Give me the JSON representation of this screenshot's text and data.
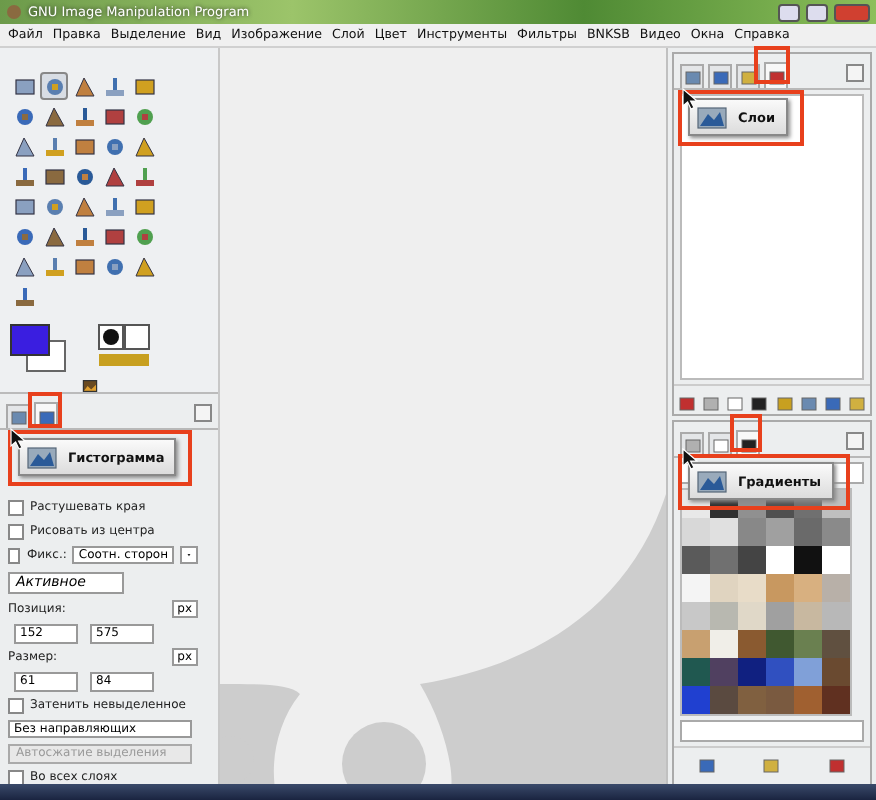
{
  "window": {
    "title": "GNU Image Manipulation Program"
  },
  "menu": [
    "Файл",
    "Правка",
    "Выделение",
    "Вид",
    "Изображение",
    "Слой",
    "Цвет",
    "Инструменты",
    "Фильтры",
    "BNKSB",
    "Видео",
    "Окна",
    "Справка"
  ],
  "toolbox": {
    "tools": [
      {
        "selected": false
      },
      {
        "selected": true
      },
      {
        "selected": false
      },
      {
        "selected": false
      },
      {
        "selected": false
      },
      {
        "selected": false
      },
      {
        "selected": false
      },
      {
        "selected": false
      },
      {
        "selected": false
      },
      {
        "selected": false
      },
      {
        "selected": false
      },
      {
        "selected": false
      },
      {
        "selected": false
      },
      {
        "selected": false
      },
      {
        "selected": false
      },
      {
        "selected": false
      },
      {
        "selected": false
      },
      {
        "selected": false
      },
      {
        "selected": false
      },
      {
        "selected": false
      },
      {
        "selected": false
      },
      {
        "selected": false
      },
      {
        "selected": false
      },
      {
        "selected": false
      },
      {
        "selected": false
      },
      {
        "selected": false
      },
      {
        "selected": false
      },
      {
        "selected": false
      },
      {
        "selected": false
      },
      {
        "selected": false
      },
      {
        "selected": false
      },
      {
        "selected": false
      },
      {
        "selected": false
      },
      {
        "selected": false
      },
      {
        "selected": false
      },
      {
        "selected": false
      }
    ]
  },
  "left_dock": {
    "tabs": [
      {
        "selected": false
      },
      {
        "selected": true
      }
    ],
    "tooltip": "Гистограмма",
    "options": [
      {
        "kind": "checkbox",
        "label": "Растушевать края",
        "checked": false
      },
      {
        "kind": "checkbox",
        "label": "Рисовать из центра",
        "checked": false
      },
      {
        "kind": "fixed",
        "label": "Фикс.:",
        "checked": false,
        "value": "Соотн. сторон"
      },
      {
        "kind": "field",
        "value": "Активное"
      },
      {
        "kind": "unit",
        "label": "Позиция:",
        "value": "px"
      },
      {
        "kind": "pair",
        "values": [
          "152",
          "575"
        ]
      },
      {
        "kind": "unit",
        "label": "Размер:",
        "value": "px"
      },
      {
        "kind": "pair",
        "values": [
          "61",
          "84"
        ]
      },
      {
        "kind": "checkbox",
        "label": "Затенить невыделенное",
        "checked": false
      },
      {
        "kind": "dropdown",
        "value": "Без направляющих"
      },
      {
        "kind": "button",
        "label": "Автосжатие выделения",
        "disabled": true
      },
      {
        "kind": "checkbox",
        "label": "Во всех слоях",
        "checked": false
      }
    ]
  },
  "layers_dock": {
    "tabs": [
      {
        "selected": false
      },
      {
        "selected": false
      },
      {
        "selected": false
      },
      {
        "selected": true
      }
    ],
    "tooltip": "Слои"
  },
  "patterns_dock": {
    "tabs": [
      {
        "selected": false
      },
      {
        "selected": false
      },
      {
        "selected": true
      }
    ],
    "tooltip": "Градиенты"
  }
}
